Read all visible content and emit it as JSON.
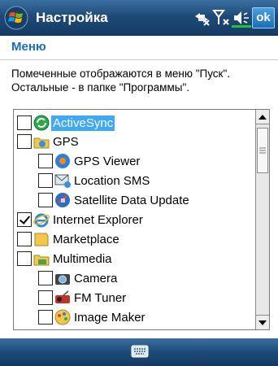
{
  "titlebar": {
    "title": "Настройка",
    "ok_label": "ok",
    "icons": [
      "windows-flag-icon",
      "connectivity-icon",
      "signal-icon",
      "volume-icon"
    ]
  },
  "header": {
    "title": "Меню",
    "hint_line1": "Помеченные отображаются в меню \"Пуск\".",
    "hint_line2": "Остальные - в папке \"Программы\"."
  },
  "list": {
    "items": [
      {
        "label": "ActiveSync",
        "checked": false,
        "selected": true,
        "icon": "activesync-icon"
      },
      {
        "label": "GPS",
        "checked": false,
        "selected": false,
        "icon": "folder-icon"
      },
      {
        "label": "GPS Viewer",
        "checked": false,
        "selected": false,
        "icon": "gps-viewer-icon"
      },
      {
        "label": "Location SMS",
        "checked": false,
        "selected": false,
        "icon": "location-sms-icon"
      },
      {
        "label": "Satellite Data Update",
        "checked": false,
        "selected": false,
        "icon": "satellite-icon"
      },
      {
        "label": "Internet Explorer",
        "checked": true,
        "selected": false,
        "icon": "internet-explorer-icon"
      },
      {
        "label": "Marketplace",
        "checked": false,
        "selected": false,
        "icon": "marketplace-icon"
      },
      {
        "label": "Multimedia",
        "checked": false,
        "selected": false,
        "icon": "folder-icon"
      },
      {
        "label": "Camera",
        "checked": false,
        "selected": false,
        "icon": "camera-icon"
      },
      {
        "label": "FM Tuner",
        "checked": false,
        "selected": false,
        "icon": "fm-tuner-icon"
      },
      {
        "label": "Image Maker",
        "checked": false,
        "selected": false,
        "icon": "image-maker-icon"
      }
    ]
  },
  "colors": {
    "accent": "#1b6cb8",
    "selection": "#3fa9f5",
    "titlebar": "#1f4a78"
  },
  "bottombar": {
    "keyboard_icon": "keyboard-icon"
  }
}
